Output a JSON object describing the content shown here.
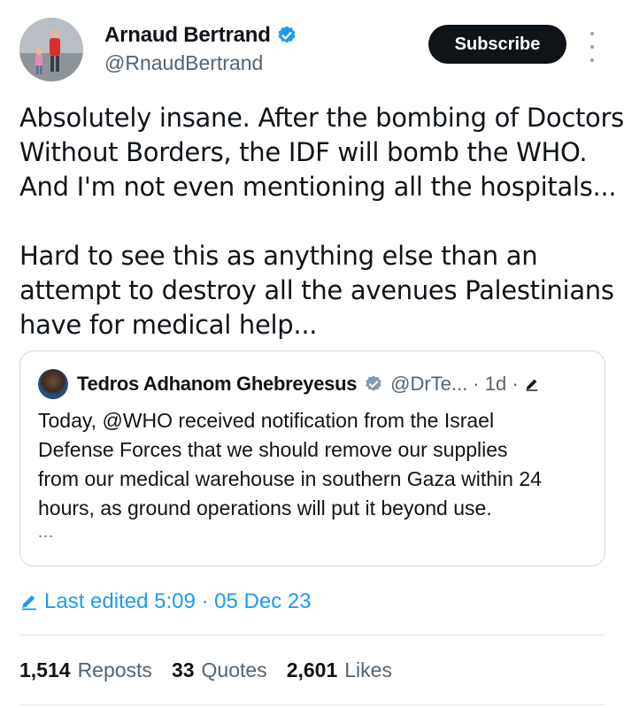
{
  "author": {
    "name": "Arnaud Bertrand",
    "handle": "@RnaudBertrand",
    "verified_color": "#1d9bf0"
  },
  "subscribe_label": "Subscribe",
  "tweet": {
    "lines_p1": [
      "Absolutely insane. After the bombing of Doctors",
      "Without Borders, the IDF will bomb the WHO.",
      "And I'm not even mentioning all the hospitals..."
    ],
    "lines_p2": [
      "Hard to see this as anything else than an",
      "attempt to destroy all the avenues Palestinians",
      "have for medical help..."
    ]
  },
  "quoted": {
    "name": "Tedros Adhanom Ghebreyesus",
    "handle": "@DrTe...",
    "time": "· 1d ·",
    "lines": [
      "Today, @WHO received notification from the Israel",
      "Defense Forces that we should remove our supplies",
      "from our medical warehouse in southern Gaza within 24",
      "hours, as ground operations will put it beyond use."
    ],
    "ellipsis": "..."
  },
  "edited_label": "Last edited 5:09 · 05 Dec 23",
  "stats": {
    "reposts": {
      "count": "1,514",
      "label": "Reposts"
    },
    "quotes": {
      "count": "33",
      "label": "Quotes"
    },
    "likes": {
      "count": "2,601",
      "label": "Likes"
    }
  },
  "colors": {
    "accent": "#1d9bf0",
    "text": "#0f1419",
    "secondary": "#536471",
    "border": "#cfd9de"
  },
  "icons": [
    "verified-badge-icon",
    "more-options-icon",
    "edit-pencil-icon",
    "gray-verified-badge-icon"
  ]
}
